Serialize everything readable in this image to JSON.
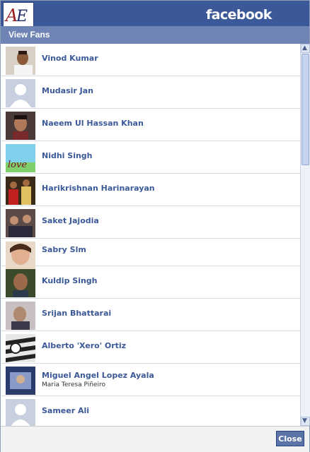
{
  "header": {
    "logo_text": "AE",
    "brand": "facebook"
  },
  "dialog": {
    "title": "View Fans",
    "close_label": "Close"
  },
  "fans": [
    {
      "name": "Vinod Kumar"
    },
    {
      "name": "Mudasir Jan"
    },
    {
      "name": "Naeem Ul Hassan Khan"
    },
    {
      "name": "Nidhi Singh"
    },
    {
      "name": "Harikrishnan Harinarayan"
    },
    {
      "name": "Saket Jajodia"
    },
    {
      "name": "Sabry Slm"
    },
    {
      "name": "Kuldip Singh"
    },
    {
      "name": "Srijan Bhattarai"
    },
    {
      "name": "Alberto 'Xero' Ortiz"
    },
    {
      "name": "Miguel Angel Lopez Ayala",
      "subtitle": "Maria Teresa Piñeiro"
    },
    {
      "name": "Sameer Ali"
    }
  ],
  "colors": {
    "brand_blue": "#3b5998",
    "titlebar": "#6d84b4",
    "link": "#3b5998"
  }
}
